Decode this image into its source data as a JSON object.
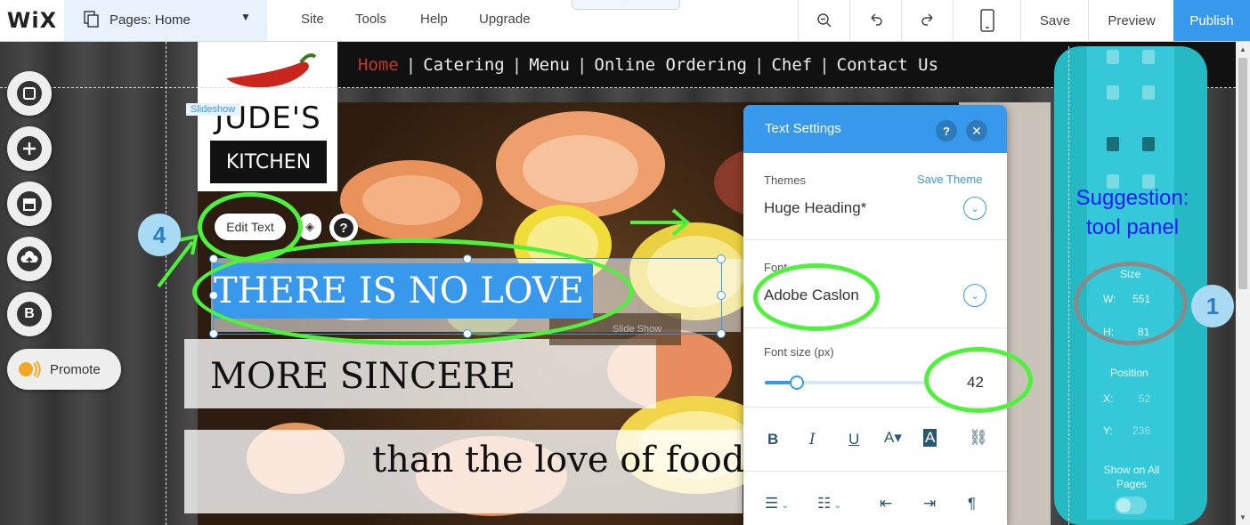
{
  "topbar": {
    "logo": "WiX",
    "pages_label": "Pages: Home",
    "menu": [
      "Site",
      "Tools",
      "Help",
      "Upgrade"
    ],
    "save": "Save",
    "preview": "Preview",
    "publish": "Publish"
  },
  "site": {
    "nav": [
      "Home",
      "Catering",
      "Menu",
      "Online Ordering",
      "Chef",
      "Contact Us"
    ],
    "logo_line1": "JUDE'S",
    "logo_line2": "KITCHEN",
    "slideshow_tag": "Slideshow",
    "slideshow_ghost": "Slide Show",
    "heading1": "THERE IS NO LOVE",
    "heading2": "MORE SINCERE",
    "heading3": "than the love of food.",
    "edit_text": "Edit Text"
  },
  "left_toolbar": {
    "promote": "Promote",
    "blog_letter": "B"
  },
  "text_settings": {
    "title": "Text Settings",
    "themes_label": "Themes",
    "save_theme": "Save Theme",
    "theme_value": "Huge Heading*",
    "font_label": "Font",
    "font_value": "Adobe Caslon",
    "font_size_label": "Font size (px)",
    "font_size_value": "42",
    "font_size_fraction": 0.2
  },
  "tool_panel": {
    "suggestion": "Suggestion: tool panel",
    "size_label": "Size",
    "w_label": "W:",
    "w_value": "551",
    "h_label": "H:",
    "h_value": "81",
    "position_label": "Position",
    "x_label": "X:",
    "x_value": "52",
    "y_label": "Y:",
    "y_value": "236",
    "show_all_pages": "Show on All Pages"
  },
  "annotations": {
    "badge1": "1",
    "badge4": "4"
  },
  "colors": {
    "accent": "#3899ec",
    "annotation_green": "#4ef23a",
    "tool_panel": "#25b9c3"
  }
}
